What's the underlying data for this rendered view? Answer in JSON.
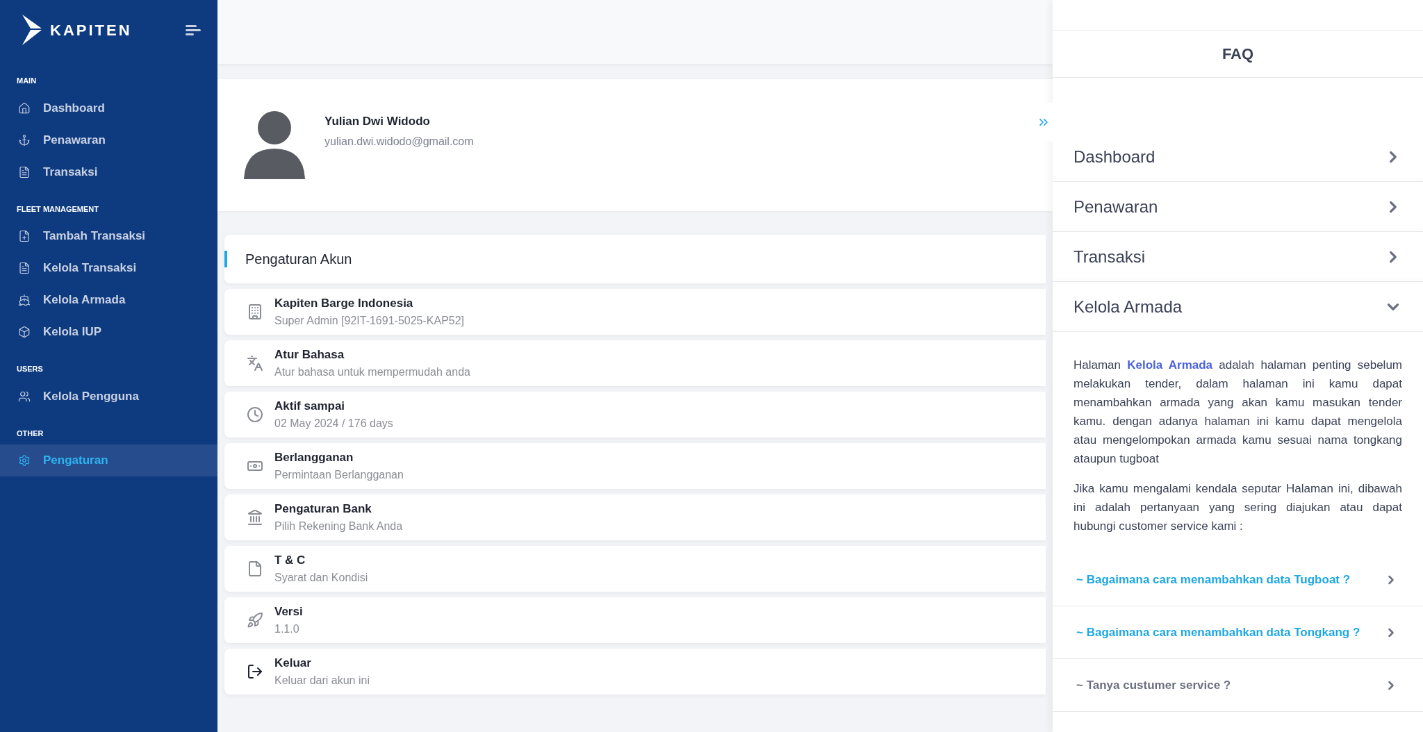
{
  "sidebar": {
    "logo": "KAPITEN",
    "sections": [
      {
        "heading": "MAIN",
        "items": [
          {
            "label": "Dashboard",
            "selected": false
          },
          {
            "label": "Penawaran",
            "selected": false
          },
          {
            "label": "Transaksi",
            "selected": false
          }
        ]
      },
      {
        "heading": "FLEET MANAGEMENT",
        "items": [
          {
            "label": "Tambah Transaksi",
            "selected": false
          },
          {
            "label": "Kelola Transaksi",
            "selected": false
          },
          {
            "label": "Kelola Armada",
            "selected": false
          },
          {
            "label": "Kelola IUP",
            "selected": false
          }
        ]
      },
      {
        "heading": "USERS",
        "items": [
          {
            "label": "Kelola Pengguna",
            "selected": false
          }
        ]
      },
      {
        "heading": "OTHER",
        "items": [
          {
            "label": "Pengaturan",
            "selected": true
          }
        ]
      }
    ]
  },
  "profile": {
    "name": "Yulian Dwi Widodo",
    "email": "yulian.dwi.widodo@gmail.com"
  },
  "settings": {
    "title": "Pengaturan Akun",
    "items": [
      {
        "title": "Kapiten Barge Indonesia",
        "subtitle": "Super Admin [92IT-1691-5025-KAP52]"
      },
      {
        "title": "Atur Bahasa",
        "subtitle": "Atur bahasa untuk mempermudah anda"
      },
      {
        "title": "Aktif sampai",
        "subtitle": "02 May 2024 / 176 days"
      },
      {
        "title": "Berlangganan",
        "subtitle": "Permintaan Berlangganan"
      },
      {
        "title": "Pengaturan Bank",
        "subtitle": "Pilih Rekening Bank Anda"
      },
      {
        "title": "T & C",
        "subtitle": "Syarat dan Kondisi"
      },
      {
        "title": "Versi",
        "subtitle": "1.1.0"
      },
      {
        "title": "Keluar",
        "subtitle": "Keluar dari akun ini"
      }
    ]
  },
  "faq": {
    "title": "FAQ",
    "sections": [
      {
        "label": "Dashboard",
        "expanded": false
      },
      {
        "label": "Penawaran",
        "expanded": false
      },
      {
        "label": "Transaksi",
        "expanded": false
      },
      {
        "label": "Kelola Armada",
        "expanded": true,
        "body": [
          "Halaman **Kelola Armada** adalah halaman penting sebelum melakukan tender, dalam halaman ini kamu dapat menambahkan armada yang akan kamu masukan tender kamu. dengan adanya halaman ini kamu dapat mengelola atau mengelompokan armada kamu sesuai nama tongkang ataupun tugboat",
          "Jika kamu mengalami kendala seputar Halaman ini, dibawah ini adalah pertanyaan yang sering diajukan atau dapat hubungi customer service kami :"
        ],
        "questions": [
          {
            "label": "~ Bagaimana cara menambahkan data Tugboat ?",
            "kind": "link"
          },
          {
            "label": "~ Bagaimana cara menambahkan data Tongkang ?",
            "kind": "link"
          },
          {
            "label": "~ Tanya custumer service ?",
            "kind": "plain"
          }
        ]
      }
    ]
  }
}
